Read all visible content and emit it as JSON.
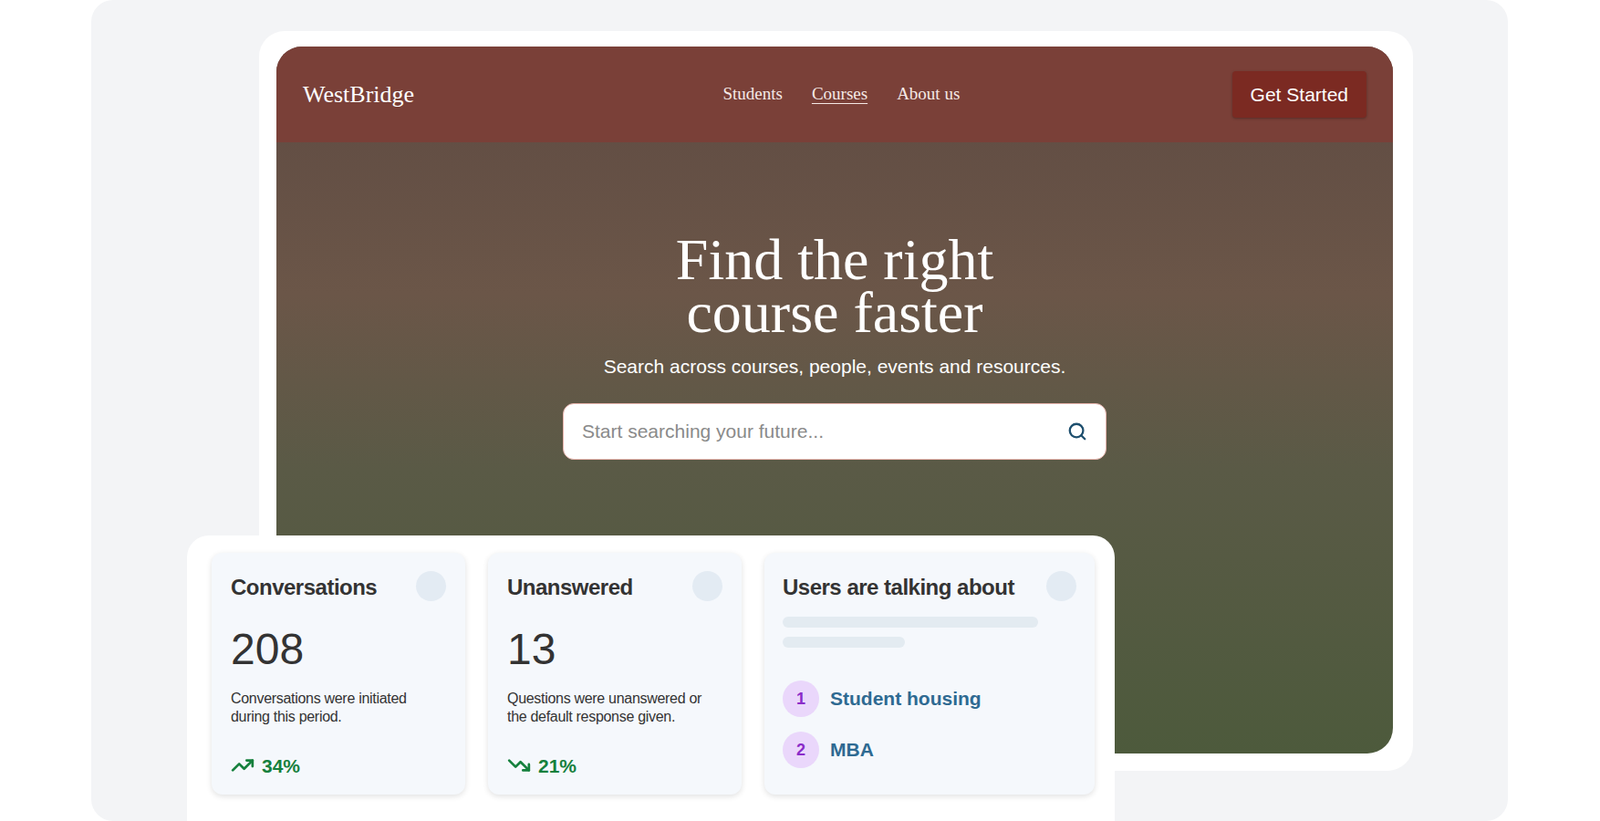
{
  "brand": "WestBridge",
  "nav": [
    {
      "label": "Students",
      "selected": false
    },
    {
      "label": "Courses",
      "selected": true
    },
    {
      "label": "About us",
      "selected": false
    }
  ],
  "cta": "Get Started",
  "hero": {
    "title_lines": [
      "Find the right",
      "course faster"
    ],
    "subtitle": "Search across courses, people, events and resources."
  },
  "search": {
    "placeholder": "Start searching your future..."
  },
  "stats": [
    {
      "title": "Conversations",
      "value": "208",
      "description": "Conversations were initiated during this period.",
      "change": "34%",
      "kind": "up"
    },
    {
      "title": "Unanswered",
      "value": "13",
      "description": "Questions were unanswered or the default response given.",
      "change": "21%",
      "kind": "down"
    }
  ],
  "topics": {
    "title": "Users are talking about",
    "items": [
      {
        "rank": "1",
        "label": "Student housing"
      },
      {
        "rank": "2",
        "label": "MBA"
      }
    ]
  }
}
